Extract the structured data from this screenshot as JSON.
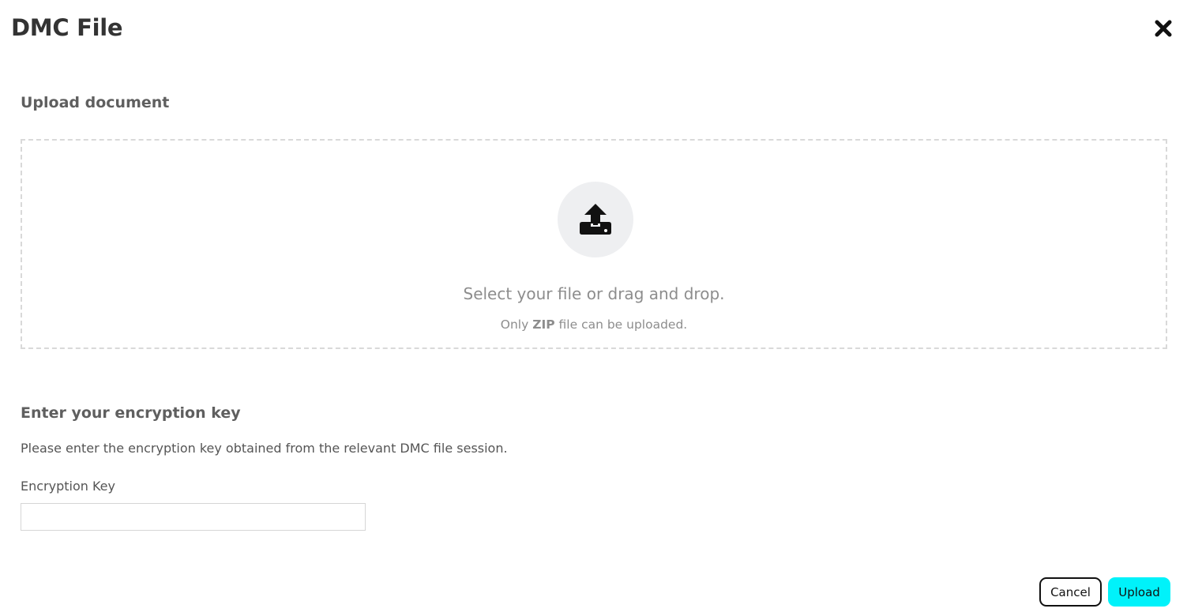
{
  "modal": {
    "title": "DMC File",
    "close_icon": "close-x-icon"
  },
  "upload": {
    "section_title": "Upload document",
    "icon": "upload-icon",
    "instruction": "Select your file or drag and drop.",
    "hint_prefix": "Only",
    "hint_bold": "ZIP",
    "hint_suffix": "file can be uploaded."
  },
  "encryption": {
    "section_title": "Enter your encryption key",
    "description": "Please enter the encryption key obtained from the relevant DMC file session.",
    "field_label": "Encryption Key",
    "field_value": "",
    "field_placeholder": ""
  },
  "actions": {
    "cancel_label": "Cancel",
    "upload_label": "Upload"
  },
  "colors": {
    "accent": "#00f2fa",
    "text_dark": "#333333",
    "text_muted": "#8d8d8d",
    "dashed_border": "#d9d9d9",
    "icon_circle_bg": "#eeeff1"
  }
}
